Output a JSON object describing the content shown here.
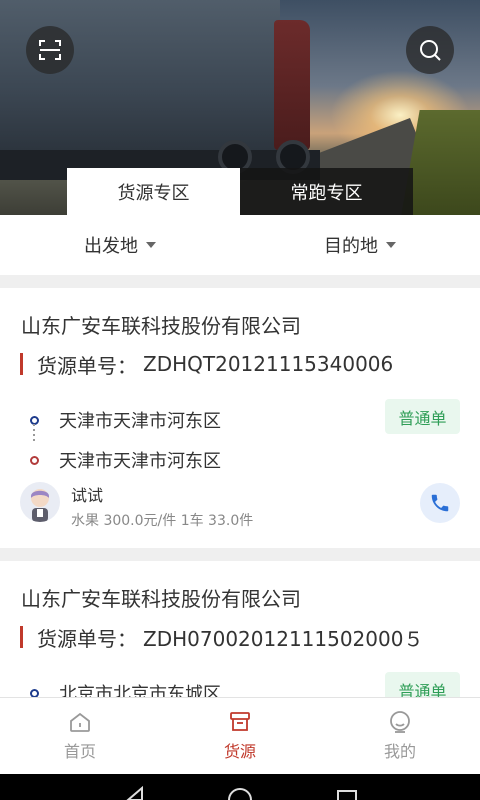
{
  "hero": {
    "tabs": [
      {
        "label": "货源专区",
        "active": true
      },
      {
        "label": "常跑专区",
        "active": false
      }
    ]
  },
  "filter": {
    "departure": "出发地",
    "destination": "目的地"
  },
  "cards": [
    {
      "company": "山东广安车联科技股份有限公司",
      "order_label": "货源单号：",
      "order_no": "ZDHQT20121115340006",
      "from": "天津市天津市河东区",
      "to": "天津市天津市河东区",
      "badge": "普通单",
      "user_name": "试试",
      "detail": "水果 300.0元/件 1车 33.0件"
    },
    {
      "company": "山东广安车联科技股份有限公司",
      "order_label": "货源单号：",
      "order_no": "ZDH07002012111502000５",
      "from": "北京市北京市东城区",
      "badge": "普通单"
    }
  ],
  "bottom_nav": [
    {
      "label": "首页",
      "icon": "home-icon",
      "active": false
    },
    {
      "label": "货源",
      "icon": "box-icon",
      "active": true
    },
    {
      "label": "我的",
      "icon": "profile-icon",
      "active": false
    }
  ],
  "colors": {
    "accent": "#c0392b",
    "badge_text": "#2f9e57",
    "badge_bg": "#e9f7ee",
    "call_icon": "#2b6fd6"
  }
}
